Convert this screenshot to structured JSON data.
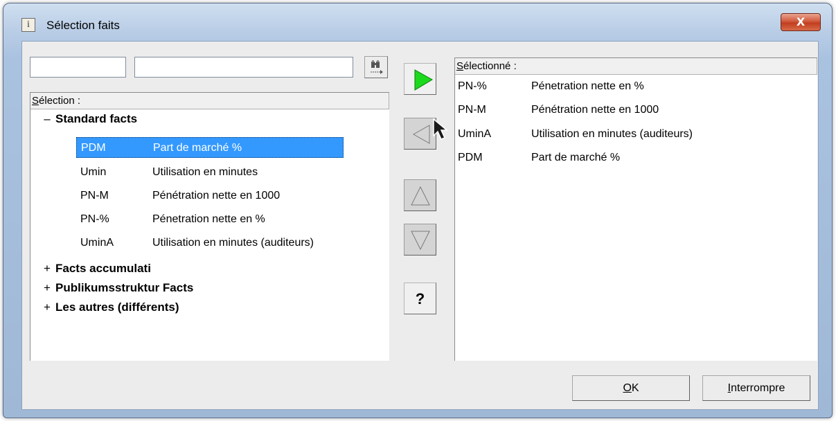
{
  "window": {
    "title": "Sélection faits",
    "icon": "info-icon",
    "icon_glyph": "i",
    "close_glyph": "X"
  },
  "search": {
    "code_value": "",
    "text_value": "",
    "find_icon": "binoculars-icon"
  },
  "left": {
    "header_hotkey": "S",
    "header_rest": "élection :",
    "groups": [
      {
        "sign": "–",
        "label": "Standard facts",
        "expanded": true
      },
      {
        "sign": "+",
        "label": "Facts accumulati",
        "expanded": false
      },
      {
        "sign": "+",
        "label": "Publikumsstruktur Facts",
        "expanded": false
      },
      {
        "sign": "+",
        "label": "Les autres (différents)",
        "expanded": false
      }
    ],
    "items": [
      {
        "code": "PDM",
        "desc": "Part de marché %",
        "selected": true
      },
      {
        "code": "Umin",
        "desc": "Utilisation en minutes",
        "selected": false
      },
      {
        "code": "PN-M",
        "desc": "Pénétration nette en 1000",
        "selected": false
      },
      {
        "code": "PN-%",
        "desc": "Pénetration nette en %",
        "selected": false
      },
      {
        "code": "UminA",
        "desc": "Utilisation en minutes (auditeurs)",
        "selected": false
      }
    ]
  },
  "middle": {
    "add_icon": "play-arrow-icon",
    "remove_icon": "left-arrow-icon",
    "up_icon": "up-arrow-icon",
    "down_icon": "down-arrow-icon",
    "help_label": "?"
  },
  "right": {
    "header_hotkey": "S",
    "header_rest": "électionné :",
    "items": [
      {
        "code": "PN-%",
        "desc": "Pénetration nette en %"
      },
      {
        "code": "PN-M",
        "desc": "Pénétration nette en 1000"
      },
      {
        "code": "UminA",
        "desc": "Utilisation en minutes (auditeurs)"
      },
      {
        "code": "PDM",
        "desc": "Part de marché %"
      }
    ]
  },
  "buttons": {
    "ok_hotkey": "O",
    "ok_rest": "K",
    "cancel_hotkey": "I",
    "cancel_rest": "nterrompre"
  },
  "colors": {
    "selection": "#3399ff",
    "add_arrow": "#1cd91c",
    "close_button": "#c94a2c"
  }
}
